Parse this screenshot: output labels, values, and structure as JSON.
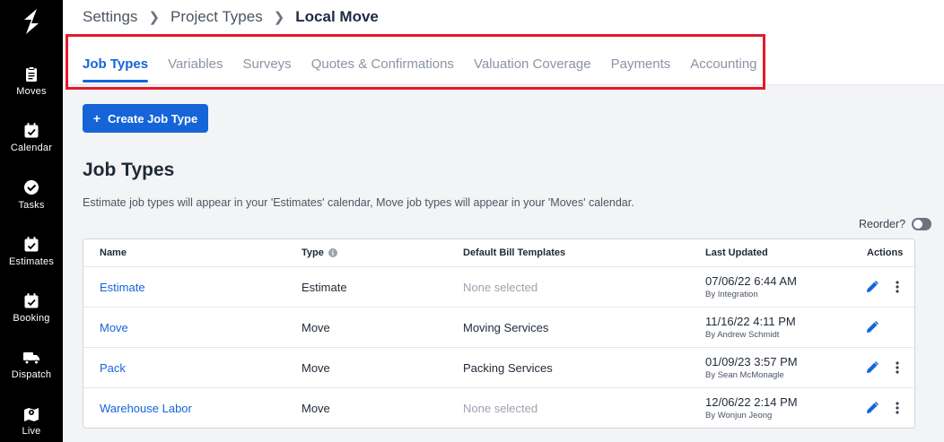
{
  "sidebar": {
    "items": [
      {
        "label": "Moves",
        "icon": "clipboard-icon"
      },
      {
        "label": "Calendar",
        "icon": "calendar-check-icon"
      },
      {
        "label": "Tasks",
        "icon": "check-circle-icon"
      },
      {
        "label": "Estimates",
        "icon": "calendar-check-icon"
      },
      {
        "label": "Booking",
        "icon": "calendar-check-icon"
      },
      {
        "label": "Dispatch",
        "icon": "truck-icon"
      },
      {
        "label": "Live",
        "icon": "map-icon"
      }
    ]
  },
  "breadcrumb": {
    "items": [
      "Settings",
      "Project Types"
    ],
    "current": "Local Move"
  },
  "tabs": [
    {
      "label": "Job Types",
      "active": true
    },
    {
      "label": "Variables",
      "active": false
    },
    {
      "label": "Surveys",
      "active": false
    },
    {
      "label": "Quotes & Confirmations",
      "active": false
    },
    {
      "label": "Valuation Coverage",
      "active": false
    },
    {
      "label": "Payments",
      "active": false
    },
    {
      "label": "Accounting",
      "active": false
    }
  ],
  "create_button": {
    "plus": "+",
    "label": "Create Job Type"
  },
  "page": {
    "title": "Job Types",
    "description": "Estimate job types will appear in your 'Estimates' calendar, Move job types will appear in your 'Moves' calendar."
  },
  "reorder": {
    "label": "Reorder?",
    "on": false
  },
  "table": {
    "columns": {
      "name": "Name",
      "type": "Type",
      "templates": "Default Bill Templates",
      "updated": "Last Updated",
      "actions": "Actions"
    },
    "rows": [
      {
        "name": "Estimate",
        "type": "Estimate",
        "templates": "None selected",
        "templates_empty": true,
        "updated": "07/06/22 6:44 AM",
        "by": "By Integration",
        "has_more": true
      },
      {
        "name": "Move",
        "type": "Move",
        "templates": "Moving Services",
        "templates_empty": false,
        "updated": "11/16/22 4:11 PM",
        "by": "By Andrew Schmidt",
        "has_more": false
      },
      {
        "name": "Pack",
        "type": "Move",
        "templates": "Packing Services",
        "templates_empty": false,
        "updated": "01/09/23 3:57 PM",
        "by": "By Sean McMonagle",
        "has_more": true
      },
      {
        "name": "Warehouse Labor",
        "type": "Move",
        "templates": "None selected",
        "templates_empty": true,
        "updated": "12/06/22 2:14 PM",
        "by": "By Wonjun Jeong",
        "has_more": true
      }
    ]
  },
  "colors": {
    "accent": "#1565d8",
    "highlight": "#e41a2a",
    "sidebar": "#000000"
  }
}
